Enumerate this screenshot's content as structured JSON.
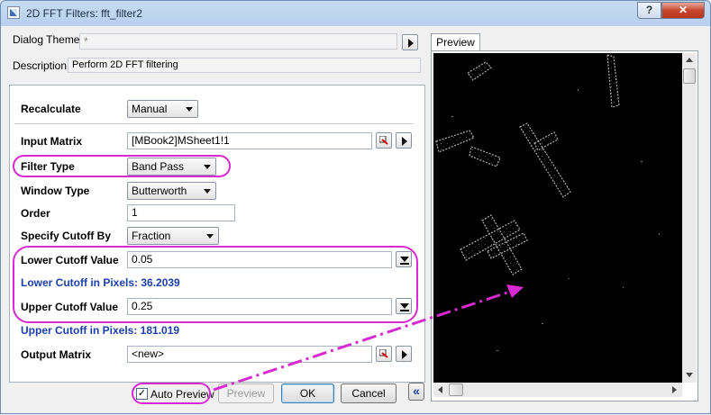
{
  "window": {
    "title": "2D FFT Filters: fft_filter2",
    "help_label": "?",
    "close_label": "✕"
  },
  "header": {
    "dialog_theme_label": "Dialog Theme",
    "dialog_theme_value": "*",
    "description_label": "Description",
    "description_value": "Perform 2D FFT filtering"
  },
  "form": {
    "recalculate_label": "Recalculate",
    "recalculate_value": "Manual",
    "input_matrix_label": "Input Matrix",
    "input_matrix_value": "[MBook2]MSheet1!1",
    "filter_type_label": "Filter Type",
    "filter_type_value": "Band Pass",
    "window_type_label": "Window Type",
    "window_type_value": "Butterworth",
    "order_label": "Order",
    "order_value": "1",
    "specify_cutoff_label": "Specify Cutoff By",
    "specify_cutoff_value": "Fraction",
    "lower_cutoff_label": "Lower Cutoff Value",
    "lower_cutoff_value": "0.05",
    "lower_pixels_text": "Lower Cutoff in Pixels: 36.2039",
    "upper_cutoff_label": "Upper Cutoff Value",
    "upper_cutoff_value": "0.25",
    "upper_pixels_text": "Upper Cutoff in Pixels: 181.019",
    "output_matrix_label": "Output Matrix",
    "output_matrix_value": "<new>"
  },
  "footer": {
    "auto_preview_label": "Auto Preview",
    "auto_preview_checked": "✓",
    "preview_button": "Preview",
    "ok_button": "OK",
    "cancel_button": "Cancel",
    "collapse_label": "«"
  },
  "preview": {
    "tab_label": "Preview"
  },
  "annotation_color": "#d829d2",
  "accent_blue": "#1a3fa8"
}
